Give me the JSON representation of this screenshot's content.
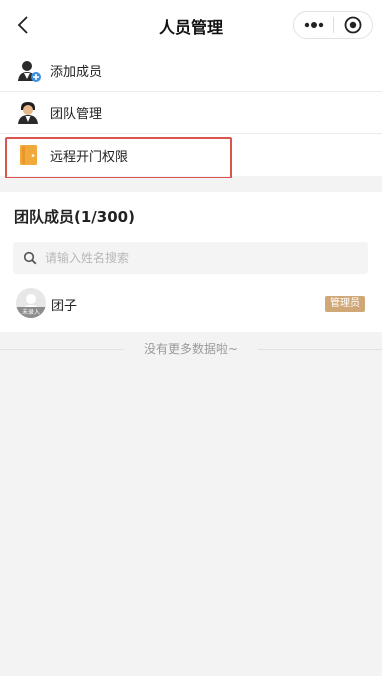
{
  "navbar": {
    "title": "人员管理",
    "back_icon": "chevron-left-icon",
    "more_icon": "more-dots-icon",
    "close_icon": "target-close-icon"
  },
  "menu": {
    "items": [
      {
        "label": "添加成员",
        "icon": "add-member-icon"
      },
      {
        "label": "团队管理",
        "icon": "team-manage-icon"
      },
      {
        "label": "远程开门权限",
        "icon": "remote-door-icon"
      }
    ]
  },
  "team": {
    "title": "团队成员(1/300)",
    "search_placeholder": "请输入姓名搜索",
    "members": [
      {
        "name": "团子",
        "avatar_badge": "未录入",
        "role": "管理员"
      }
    ]
  },
  "footer": {
    "no_more": "没有更多数据啦~"
  },
  "colors": {
    "highlight": "#d9534f",
    "role_badge": "#d0a777",
    "door_icon": "#f2a93b"
  }
}
